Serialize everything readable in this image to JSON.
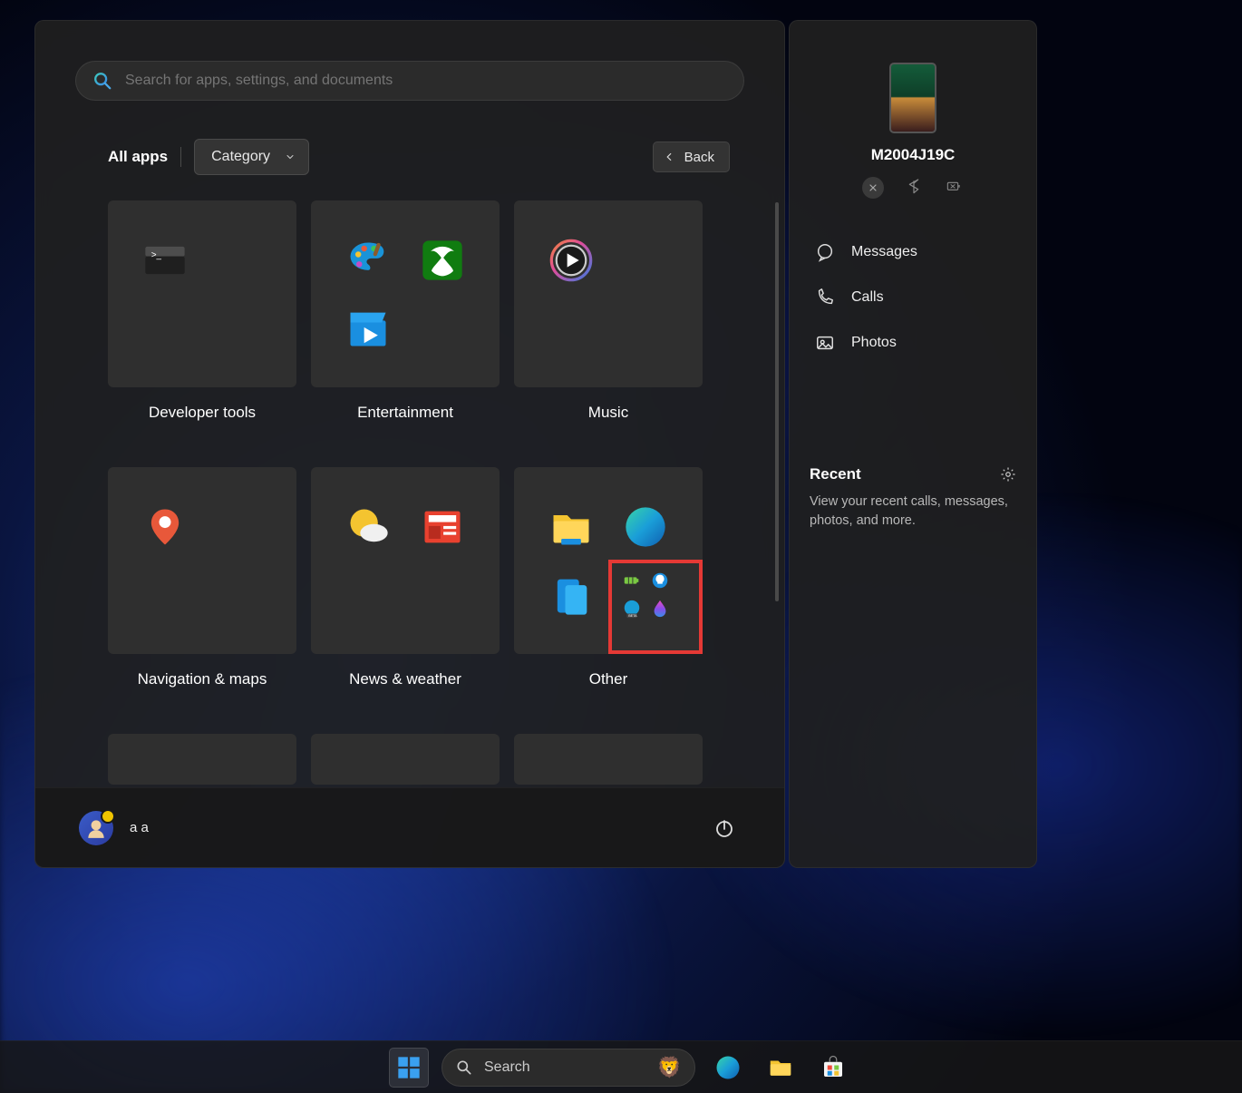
{
  "search": {
    "placeholder": "Search for apps, settings, and documents"
  },
  "header": {
    "all_apps": "All apps",
    "dropdown": "Category",
    "back": "Back"
  },
  "categories": [
    {
      "label": "Developer tools"
    },
    {
      "label": "Entertainment"
    },
    {
      "label": "Music"
    },
    {
      "label": "Navigation & maps"
    },
    {
      "label": "News & weather"
    },
    {
      "label": "Other"
    }
  ],
  "footer": {
    "username": "a a"
  },
  "phone": {
    "device_name": "M2004J19C",
    "links": [
      {
        "label": "Messages",
        "icon": "message-icon"
      },
      {
        "label": "Calls",
        "icon": "phone-icon"
      },
      {
        "label": "Photos",
        "icon": "photo-icon"
      }
    ],
    "recent_title": "Recent",
    "recent_desc": "View your recent calls, messages, photos, and more."
  },
  "taskbar": {
    "search_placeholder": "Search"
  }
}
